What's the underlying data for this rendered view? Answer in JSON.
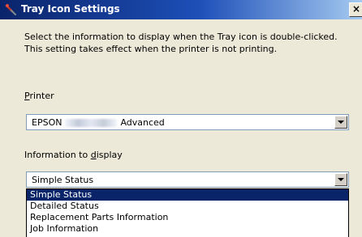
{
  "window": {
    "title": "Tray Icon Settings",
    "close_glyph": "×"
  },
  "description": "Select the information to display when the Tray icon is double-clicked. This setting takes effect when the printer is not printing.",
  "printer": {
    "label_accel": "P",
    "label_rest": "rinter",
    "value_prefix": "EPSON",
    "value_suffix": "Advanced"
  },
  "info": {
    "label_pre": "Information to ",
    "label_accel": "d",
    "label_post": "isplay",
    "selected": "Simple Status",
    "options": [
      "Simple Status",
      "Detailed Status",
      "Replacement Parts Information",
      "Job Information"
    ]
  },
  "colors": {
    "title_gradient_start": "#0a246a",
    "selection": "#0a246a"
  }
}
